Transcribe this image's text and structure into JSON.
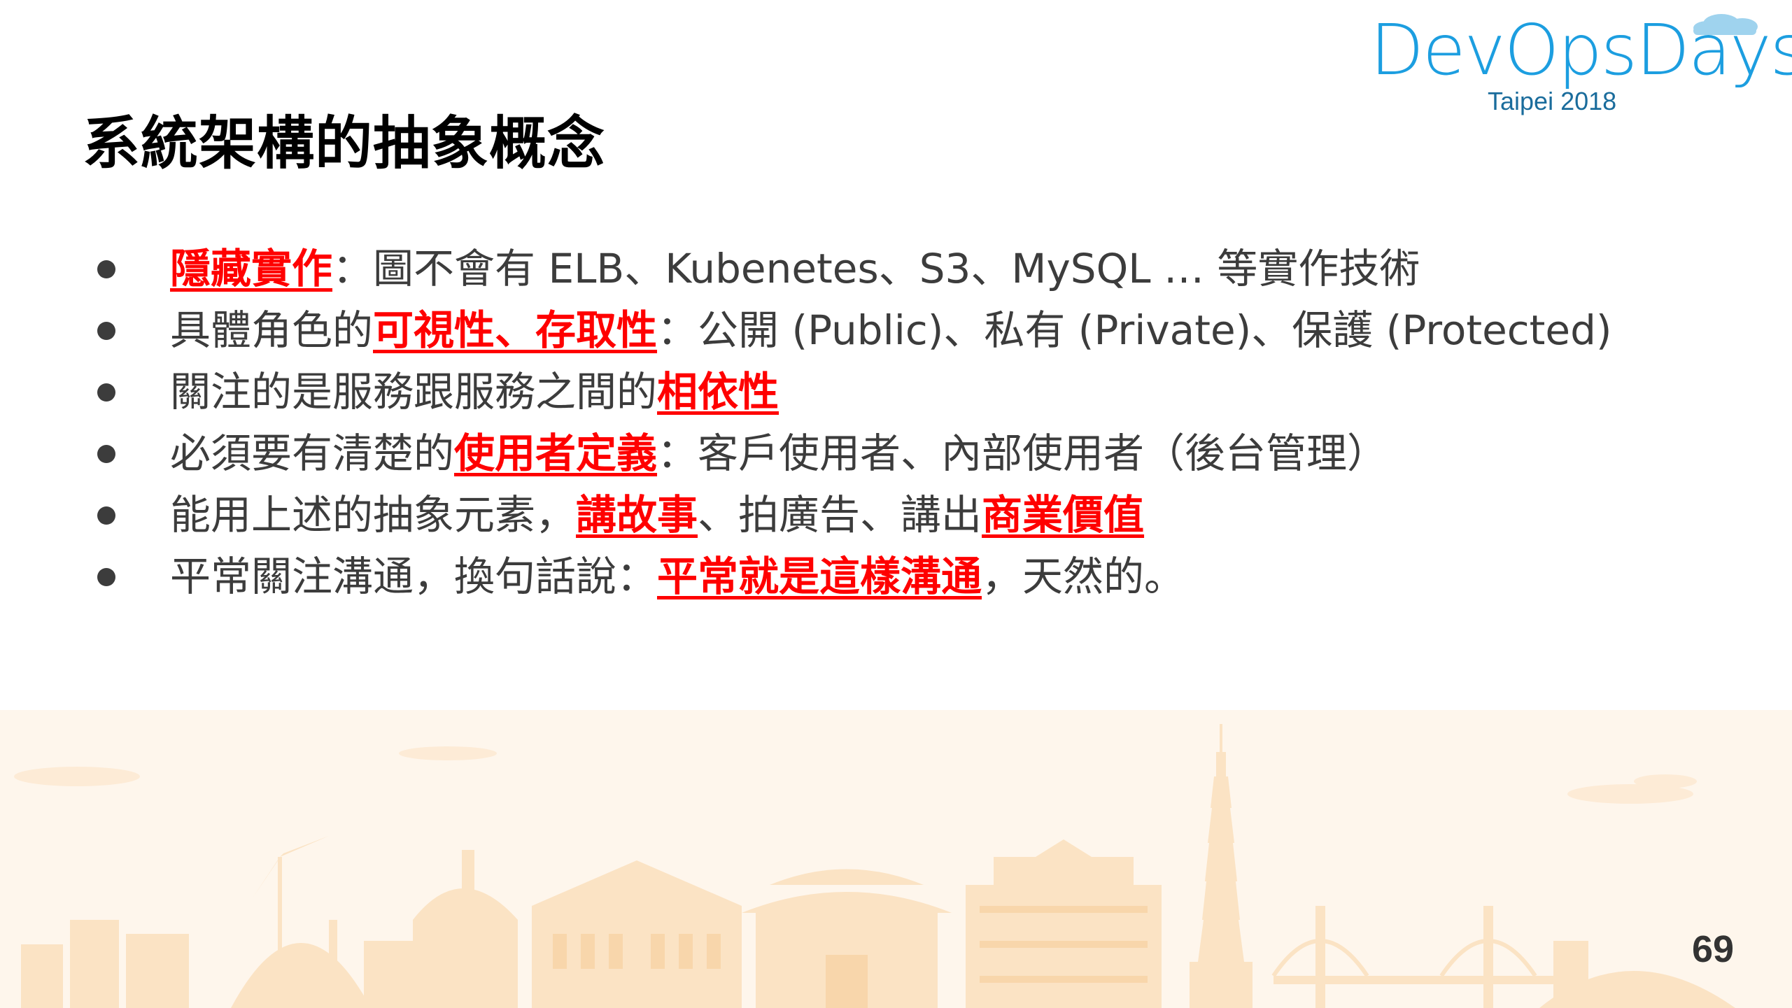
{
  "slide": {
    "title": "系統架構的抽象概念",
    "logo": {
      "word": "DevOpsDays",
      "sub": "Taipei 2018"
    },
    "bullets": [
      {
        "parts": [
          {
            "text": "隱藏實作",
            "highlight": true
          },
          {
            "text": "：圖不會有 ELB、Kubenetes、S3、MySQL … 等實作技術",
            "highlight": false
          }
        ]
      },
      {
        "parts": [
          {
            "text": "具體角色的",
            "highlight": false
          },
          {
            "text": "可視性、存取性",
            "highlight": true
          },
          {
            "text": "：公開 (Public)、私有 (Private)、保護 (Protected)",
            "highlight": false
          }
        ]
      },
      {
        "parts": [
          {
            "text": "關注的是服務跟服務之間的",
            "highlight": false
          },
          {
            "text": "相依性",
            "highlight": true
          }
        ]
      },
      {
        "parts": [
          {
            "text": "必須要有清楚的",
            "highlight": false
          },
          {
            "text": "使用者定義",
            "highlight": true
          },
          {
            "text": "：客戶使用者、內部使用者（後台管理）",
            "highlight": false
          }
        ]
      },
      {
        "parts": [
          {
            "text": "能用上述的抽象元素，",
            "highlight": false
          },
          {
            "text": "講故事",
            "highlight": true
          },
          {
            "text": "、拍廣告、講出",
            "highlight": false
          },
          {
            "text": "商業價值",
            "highlight": true
          }
        ]
      },
      {
        "parts": [
          {
            "text": "平常關注溝通，換句話說：",
            "highlight": false
          },
          {
            "text": "平常就是這樣溝通",
            "highlight": true
          },
          {
            "text": "，天然的。",
            "highlight": false
          }
        ]
      }
    ],
    "page_number": "69"
  },
  "colors": {
    "highlight": "#ff0000",
    "body_text": "#3c3c3c",
    "title": "#000000",
    "logo_blue": "#1c9ee0",
    "skyline": "#fbe3c4",
    "skyline_bg": "#fef6ec"
  },
  "icons": {
    "bullet": "filled-circle",
    "logo_cloud": "cloud-icon"
  }
}
